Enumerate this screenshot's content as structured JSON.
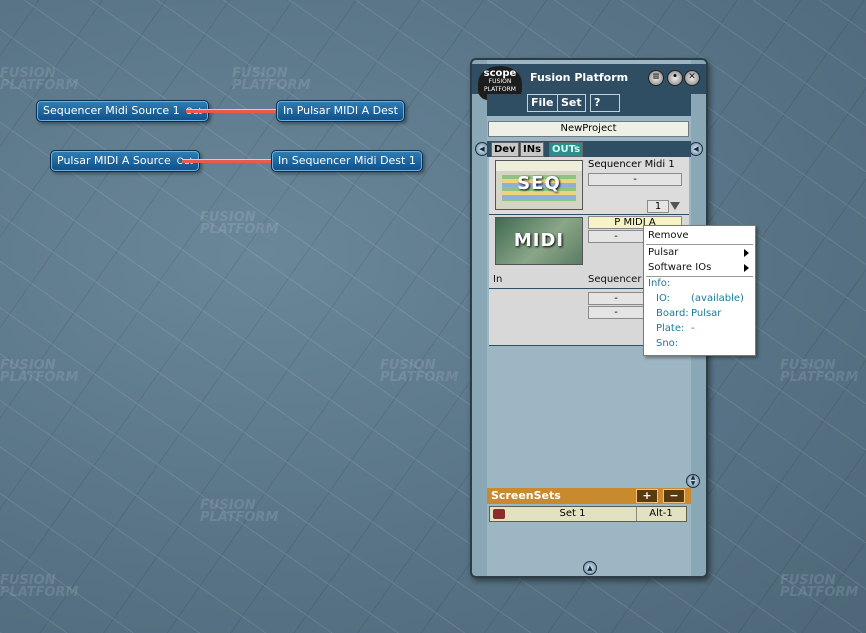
{
  "desktop": {
    "watermark_line1": "FUSION",
    "watermark_line2": "PLATFORM"
  },
  "routing": {
    "cable1": {
      "source_label": "Sequencer Midi Source 1",
      "source_port": "Out",
      "dest_label": "In Pulsar MIDI A Dest"
    },
    "cable2": {
      "source_label": "Pulsar MIDI A Source",
      "source_port": "Out",
      "dest_label": "In Sequencer Midi Dest 1"
    },
    "cable_color": "#e65b4a"
  },
  "window": {
    "title": "Fusion Platform",
    "logo_line1": "scope",
    "logo_line2": "FUSION PLATFORM",
    "menu": [
      "File",
      "Set",
      "?"
    ],
    "project_name": "NewProject",
    "tabs": [
      "Dev",
      "INs",
      "OUTs"
    ],
    "active_tab": "OUTs",
    "devices": [
      {
        "thumb_label": "SEQ",
        "name": "Sequencer Midi  1",
        "field2": "-",
        "count": "1"
      },
      {
        "thumb_label": "MIDI",
        "name": "P MIDI A",
        "field2": "-",
        "port_label": "In",
        "sub_name": "Sequencer",
        "field3": "-",
        "field4": "-"
      }
    ],
    "screensets": {
      "title": "ScreenSets",
      "add": "+",
      "remove": "−",
      "rows": [
        {
          "name": "Set 1",
          "shortcut": "Alt-1"
        }
      ]
    },
    "accent_color": "#2f4d63",
    "screensets_color": "#c98a2e"
  },
  "context_menu": {
    "items": [
      {
        "label": "Remove",
        "submenu": false
      },
      {
        "label": "Pulsar",
        "submenu": true
      },
      {
        "label": "Software IOs",
        "submenu": true
      }
    ],
    "info_header": "Info:",
    "info": [
      {
        "key": "IO:",
        "value": "(available)"
      },
      {
        "key": "Board:",
        "value": "Pulsar"
      },
      {
        "key": "Plate:",
        "value": "-"
      },
      {
        "key": "Sno:",
        "value": ""
      }
    ]
  }
}
